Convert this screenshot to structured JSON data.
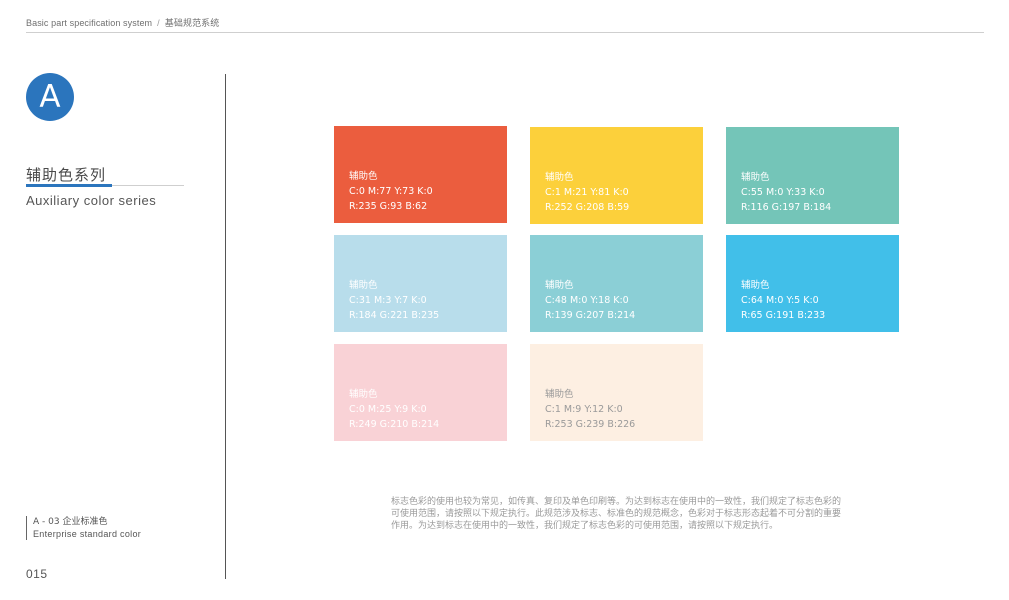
{
  "header": {
    "en": "Basic part specification system",
    "separator": "/",
    "cn": "基础规范系统"
  },
  "badge": {
    "letter": "A",
    "color": "#2b75bd"
  },
  "section": {
    "title_cn": "辅助色系列",
    "title_en": "Auxiliary color series"
  },
  "footer": {
    "code": "A - 03  企业标准色",
    "subtitle": "Enterprise standard color",
    "page": "015"
  },
  "swatches": [
    {
      "name": "辅助色",
      "cmyk": "C:0  M:77  Y:73  K:0",
      "rgb": "R:235  G:93  B:62",
      "color": "#eb5d3e",
      "text_color": "#ffffff"
    },
    {
      "name": "辅助色",
      "cmyk": "C:1  M:21  Y:81  K:0",
      "rgb": "R:252  G:208  B:59",
      "color": "#fcd03b",
      "text_color": "#ffffff"
    },
    {
      "name": "辅助色",
      "cmyk": "C:55  M:0  Y:33  K:0",
      "rgb": "R:116  G:197  B:184",
      "color": "#74c5b8",
      "text_color": "#ffffff"
    },
    {
      "name": "辅助色",
      "cmyk": "C:31  M:3  Y:7  K:0",
      "rgb": "R:184  G:221  B:235",
      "color": "#b8ddeb",
      "text_color": "#ffffff"
    },
    {
      "name": "辅助色",
      "cmyk": "C:48  M:0  Y:18  K:0",
      "rgb": "R:139  G:207  B:214",
      "color": "#8bcfd6",
      "text_color": "#ffffff"
    },
    {
      "name": "辅助色",
      "cmyk": "C:64  M:0  Y:5  K:0",
      "rgb": "R:65  G:191  B:233",
      "color": "#41bfe9",
      "text_color": "#ffffff"
    },
    {
      "name": "辅助色",
      "cmyk": "C:0  M:25  Y:9  K:0",
      "rgb": "R:249  G:210  B:214",
      "color": "#f9d2d6",
      "text_color": "#ffffff"
    },
    {
      "name": "辅助色",
      "cmyk": "C:1  M:9  Y:12  K:0",
      "rgb": "R:253  G:239  B:226",
      "color": "#fdefe2",
      "text_color": "#9a9a9a"
    }
  ],
  "description": "标志色彩的使用也较为常见，如传真、复印及单色印刷等。为达到标志在使用中的一致性，我们规定了标志色彩的可使用范围，请按照以下规定执行。此规范涉及标志、标准色的规范概念，色彩对于标志形态起着不可分割的重要作用。为达到标志在使用中的一致性，我们规定了标志色彩的可使用范围，请按照以下规定执行。"
}
